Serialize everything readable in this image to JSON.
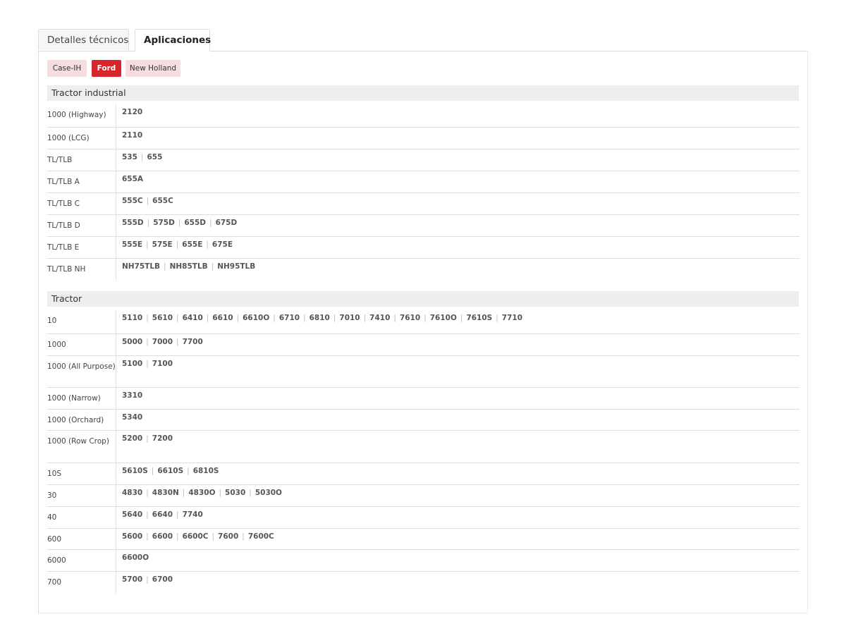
{
  "tabs": [
    {
      "label": "Detalles técnicos"
    },
    {
      "label": "Aplicaciones"
    }
  ],
  "brands": [
    {
      "label": "Case-IH"
    },
    {
      "label": "Ford"
    },
    {
      "label": "New Holland"
    }
  ],
  "sections": [
    {
      "title": "Tractor industrial",
      "rows": [
        {
          "label": "1000 (Highway)",
          "models": [
            "2120"
          ]
        },
        {
          "label": "1000 (LCG)",
          "models": [
            "2110"
          ]
        },
        {
          "label": "TL/TLB",
          "models": [
            "535",
            "655"
          ]
        },
        {
          "label": "TL/TLB A",
          "models": [
            "655A"
          ]
        },
        {
          "label": "TL/TLB C",
          "models": [
            "555C",
            "655C"
          ]
        },
        {
          "label": "TL/TLB D",
          "models": [
            "555D",
            "575D",
            "655D",
            "675D"
          ]
        },
        {
          "label": "TL/TLB E",
          "models": [
            "555E",
            "575E",
            "655E",
            "675E"
          ]
        },
        {
          "label": "TL/TLB NH",
          "models": [
            "NH75TLB",
            "NH85TLB",
            "NH95TLB"
          ]
        }
      ]
    },
    {
      "title": "Tractor",
      "rows": [
        {
          "label": "10",
          "models": [
            "5110",
            "5610",
            "6410",
            "6610",
            "6610O",
            "6710",
            "6810",
            "7010",
            "7410",
            "7610",
            "7610O",
            "7610S",
            "7710"
          ]
        },
        {
          "label": "1000",
          "models": [
            "5000",
            "7000",
            "7700"
          ]
        },
        {
          "label": "1000 (All Purpose)",
          "models": [
            "5100",
            "7100"
          ]
        },
        {
          "label": "1000 (Narrow)",
          "models": [
            "3310"
          ]
        },
        {
          "label": "1000 (Orchard)",
          "models": [
            "5340"
          ]
        },
        {
          "label": "1000 (Row Crop)",
          "models": [
            "5200",
            "7200"
          ]
        },
        {
          "label": "10S",
          "models": [
            "5610S",
            "6610S",
            "6810S"
          ]
        },
        {
          "label": "30",
          "models": [
            "4830",
            "4830N",
            "4830O",
            "5030",
            "5030O"
          ]
        },
        {
          "label": "40",
          "models": [
            "5640",
            "6640",
            "7740"
          ]
        },
        {
          "label": "600",
          "models": [
            "5600",
            "6600",
            "6600C",
            "7600",
            "7600C"
          ]
        },
        {
          "label": "6000",
          "models": [
            "6600O"
          ]
        },
        {
          "label": "700",
          "models": [
            "5700",
            "6700"
          ]
        }
      ]
    }
  ]
}
